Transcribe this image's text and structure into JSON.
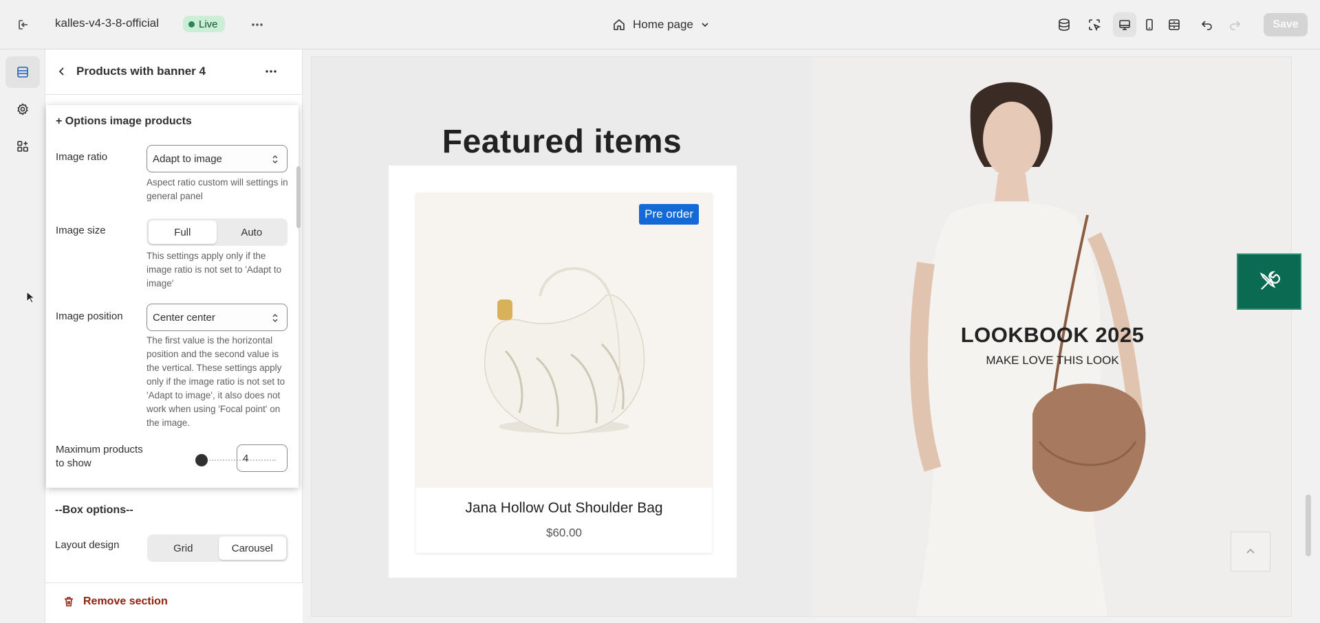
{
  "topbar": {
    "store_name": "kalles-v4-3-8-official",
    "live_label": "Live",
    "page_label": "Home page",
    "save_label": "Save"
  },
  "panel": {
    "title": "Products with banner 4",
    "section_options_title": "+ Options image products",
    "image_ratio": {
      "label": "Image ratio",
      "value": "Adapt to image",
      "help": "Aspect ratio custom will settings in general panel"
    },
    "image_size": {
      "label": "Image size",
      "options": [
        "Full",
        "Auto"
      ],
      "selected": "Full",
      "help": "This settings apply only if the image ratio is not set to 'Adapt to image'"
    },
    "image_position": {
      "label": "Image position",
      "value": "Center center",
      "help": "The first value is the horizontal position and the second value is the vertical. These settings apply only if the image ratio is not set to 'Adapt to image', it also does not work when using 'Focal point' on the image."
    },
    "max_products": {
      "label": "Maximum products to show",
      "value": "4"
    },
    "box_options_title": "--Box options--",
    "layout_design": {
      "label": "Layout design",
      "options": [
        "Grid",
        "Carousel"
      ],
      "selected": "Carousel"
    },
    "remove_label": "Remove section"
  },
  "preview": {
    "featured_title": "Featured items",
    "product": {
      "badge": "Pre order",
      "name": "Jana Hollow Out Shoulder Bag",
      "price": "$60.00"
    },
    "banner": {
      "title": "LOOKBOOK 2025",
      "subtitle": "MAKE LOVE THIS LOOK"
    }
  },
  "colors": {
    "live_badge_bg": "#cdeed6",
    "preorder_badge": "#1469d6",
    "tool_button": "#0b6b52",
    "remove_text": "#8e1f0b"
  }
}
